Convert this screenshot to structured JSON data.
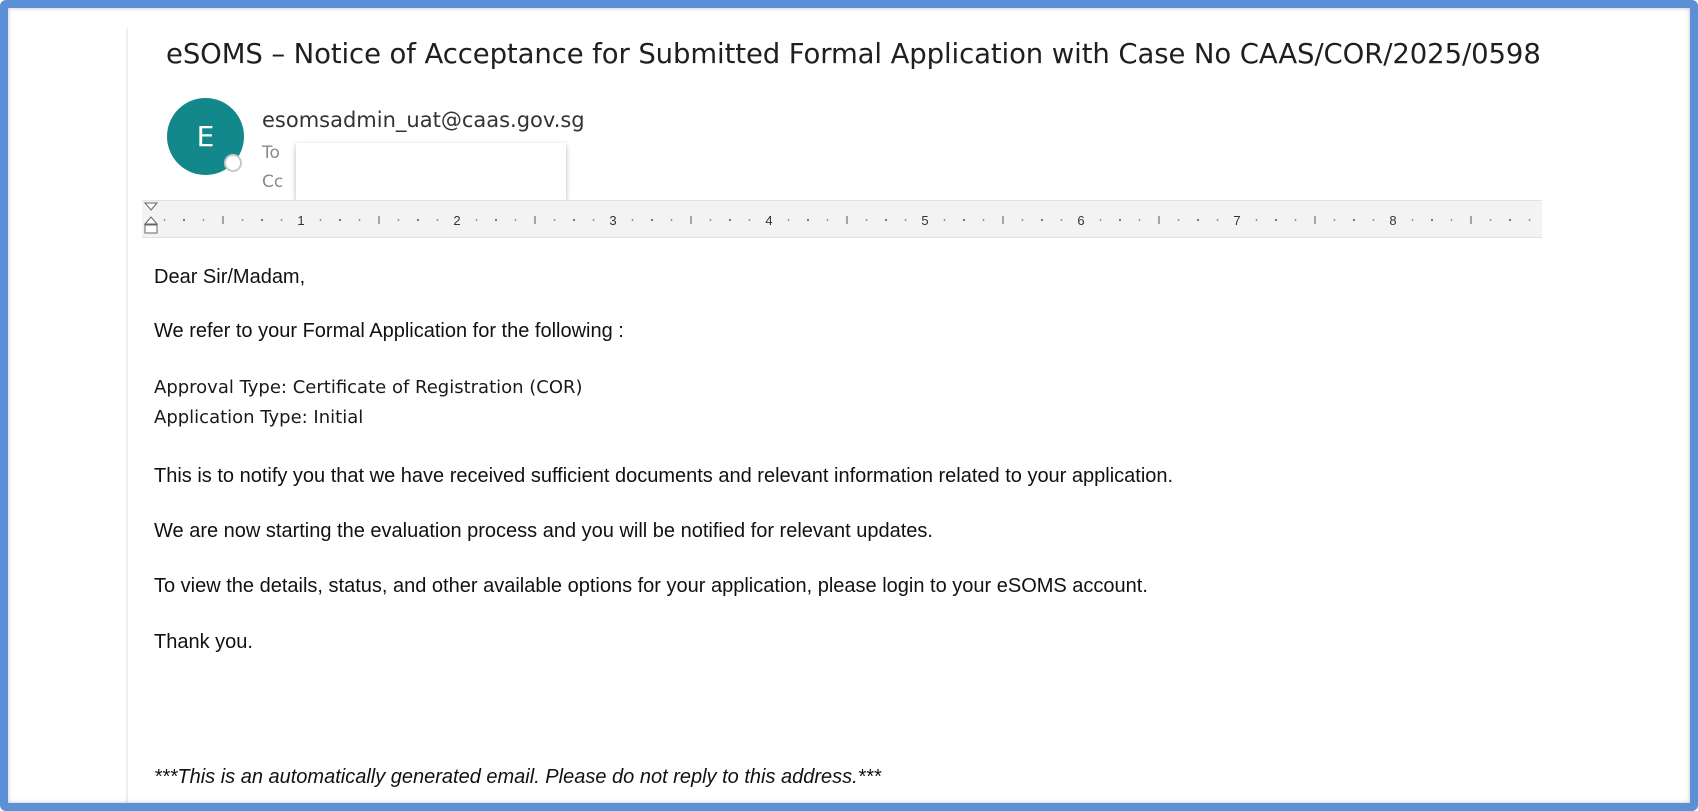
{
  "email": {
    "subject": "eSOMS – Notice of Acceptance for Submitted Formal Application with Case No CAAS/COR/2025/0598",
    "sender_initial": "E",
    "sender": "esomsadmin_uat@caas.gov.sg",
    "to_label": "To",
    "cc_label": "Cc",
    "avatar_color": "#12888a"
  },
  "ruler": {
    "numbers": [
      "1",
      "2",
      "3",
      "4",
      "5",
      "6",
      "7",
      "8"
    ]
  },
  "body": {
    "greeting": "Dear Sir/Madam,",
    "intro": "We refer to your Formal Application for the following :",
    "approval_type": "Approval Type: Certificate of Registration (COR)",
    "application_type": "Application Type: Initial",
    "para1": "This is to notify you that we have received sufficient documents and relevant information related to your application.",
    "para2": "We are now starting the evaluation process and you will be notified for relevant updates.",
    "para3": "To view the details, status, and other available options for your application, please login to your eSOMS account.",
    "thanks": "Thank you.",
    "footer": "***This is an automatically generated email. Please do not reply to this address.***"
  },
  "colors": {
    "frame_border": "#5b8fd6"
  }
}
